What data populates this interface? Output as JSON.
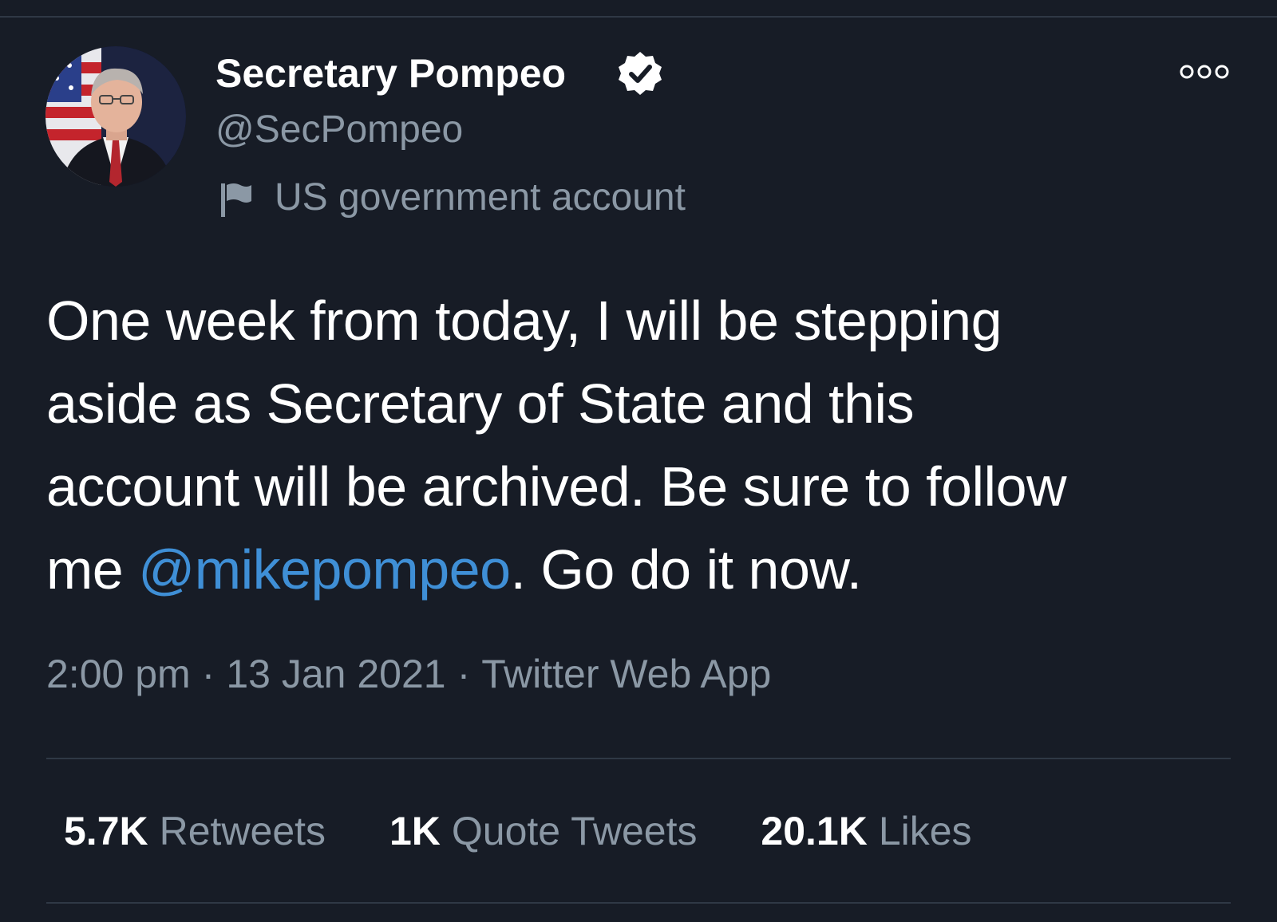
{
  "tweet": {
    "author": {
      "display_name": "Secretary Pompeo",
      "handle": "@SecPompeo",
      "verified": true,
      "label": "US government account"
    },
    "text_lines": [
      "One week from today, I will be stepping",
      "aside as Secretary of State and this",
      "account will be archived. Be sure to follow"
    ],
    "last_line": {
      "before": "me ",
      "mention": "@mikepompeo",
      "after": ". Go do it now."
    },
    "meta": {
      "time": "2:00 pm",
      "date": "13 Jan 2021",
      "source": "Twitter Web App",
      "separator": "·"
    },
    "stats": [
      {
        "count": "5.7K",
        "label": "Retweets"
      },
      {
        "count": "1K",
        "label": "Quote Tweets"
      },
      {
        "count": "20.1K",
        "label": "Likes"
      }
    ]
  },
  "icons": {
    "verified": "verified-badge-icon",
    "government": "flag-icon",
    "more": "more-options-icon"
  },
  "colors": {
    "background": "#171c26",
    "text_primary": "#ffffff",
    "text_secondary": "#8b98a5",
    "mention": "#3f8fd6",
    "divider": "#2f3845"
  }
}
